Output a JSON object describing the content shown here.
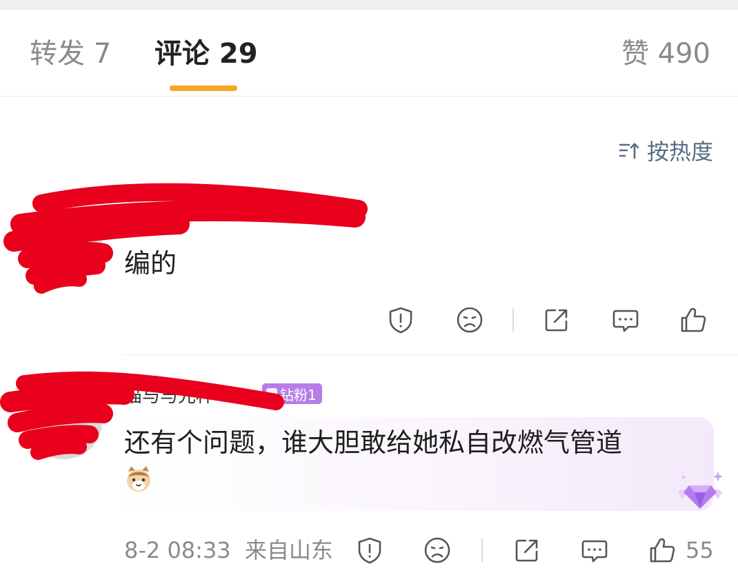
{
  "tabs": {
    "repost": "转发 7",
    "comments": "评论 29",
    "likes": "赞 490"
  },
  "sort": {
    "label": "按热度",
    "icon": "sort-icon"
  },
  "comments": [
    {
      "text": "编的",
      "actions": [
        "report-icon",
        "dislike-icon",
        "share-icon",
        "reply-icon",
        "like-icon"
      ]
    },
    {
      "username": "猫与与光杯",
      "badge": "钻粉1",
      "text": "还有个问题，谁大胆敢给她私自改燃气管道",
      "emoji": "cat-emoji",
      "meta": {
        "date": "8-2 08:33",
        "location": "来自山东"
      },
      "like_count": "55",
      "decoration": "diamond-fan-icon"
    }
  ],
  "colors": {
    "accent": "#f5a623",
    "sort_text": "#5a6b85",
    "badge": "#b67de8",
    "redaction": "#e8001c"
  }
}
